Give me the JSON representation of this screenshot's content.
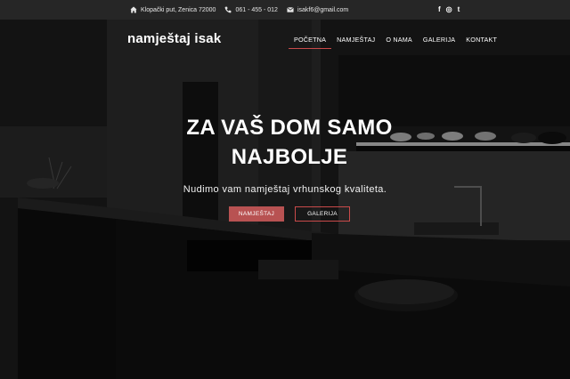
{
  "topbar": {
    "address": "Klopački put, Zenica 72000",
    "phone": "061 - 455 - 012",
    "email": "isakf6@gmail.com",
    "social": [
      "f",
      "◎",
      "t"
    ]
  },
  "header": {
    "logo": "namještaj isak",
    "nav": [
      "POČETNA",
      "NAMJEŠTAJ",
      "O NAMA",
      "GALERIJA",
      "KONTAKT"
    ]
  },
  "hero": {
    "headline_line1": "ZA VAŠ DOM SAMO",
    "headline_line2": "NAJBOLJE",
    "subtitle": "Nudimo vam namještaj vrhunskog kvaliteta.",
    "btn_primary": "NAMJEŠTAJ",
    "btn_secondary": "GALERIJA"
  },
  "colors": {
    "accent": "#c94a4a",
    "topbar": "#262626"
  },
  "icons": {
    "address": "home-icon",
    "phone": "phone-icon",
    "email": "envelope-icon"
  }
}
